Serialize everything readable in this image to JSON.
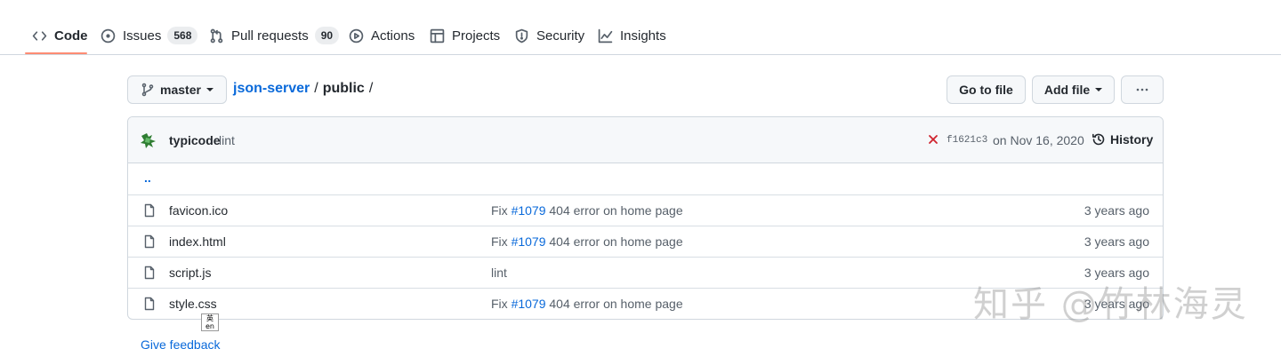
{
  "nav": {
    "tabs": [
      {
        "label": "Code",
        "icon": "code-icon"
      },
      {
        "label": "Issues",
        "count": "568",
        "icon": "issue-opened-icon"
      },
      {
        "label": "Pull requests",
        "count": "90",
        "icon": "git-pull-request-icon"
      },
      {
        "label": "Actions",
        "icon": "play-icon"
      },
      {
        "label": "Projects",
        "icon": "table-icon"
      },
      {
        "label": "Security",
        "icon": "shield-icon"
      },
      {
        "label": "Insights",
        "icon": "graph-icon"
      }
    ],
    "selected": "Code",
    "accent_color": "#fd8c73"
  },
  "branch": {
    "name": "master"
  },
  "breadcrumb": {
    "repo": "json-server",
    "separator": "/",
    "dir": "public",
    "trailing": "/"
  },
  "actions": {
    "goto_file": "Go to file",
    "add_file": "Add file",
    "more": "..."
  },
  "latest_commit": {
    "author": "typicode",
    "message": "lint",
    "status": "failure",
    "status_color": "#cf222e",
    "sha": "f1621c3",
    "date": "on Nov 16, 2020",
    "history_label": "History"
  },
  "files": {
    "updir": "..",
    "rows": [
      {
        "name": "favicon.ico",
        "commit_prefix": "Fix ",
        "issue": "#1079",
        "commit_suffix": " 404 error on home page",
        "age": "3 years ago"
      },
      {
        "name": "index.html",
        "commit_prefix": "Fix ",
        "issue": "#1079",
        "commit_suffix": " 404 error on home page",
        "age": "3 years ago"
      },
      {
        "name": "script.js",
        "commit_prefix": "lint",
        "issue": "",
        "commit_suffix": "",
        "age": "3 years ago"
      },
      {
        "name": "style.css",
        "commit_prefix": "Fix ",
        "issue": "#1079",
        "commit_suffix": " 404 error on home page",
        "age": "3 years ago"
      }
    ]
  },
  "feedback": "Give feedback",
  "ime": {
    "top": "英",
    "bottom": "en"
  },
  "watermark": "知乎 @竹林海灵"
}
